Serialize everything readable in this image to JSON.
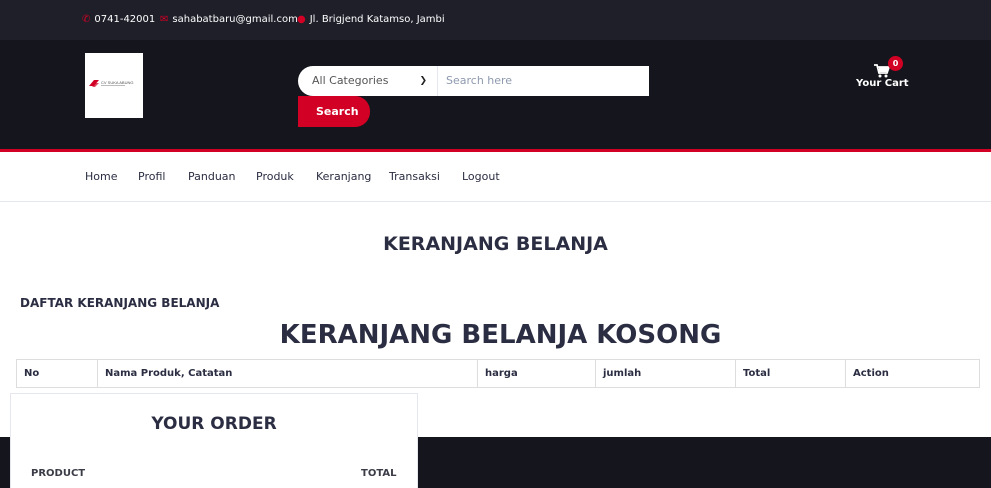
{
  "topbar": {
    "phone": "0741-42001",
    "email": "sahabatbaru@gmail.com",
    "address": "Jl. Brigjend Katamso, Jambi"
  },
  "brand": {
    "logo_text": "CV SUKA ABUNG",
    "colors": {
      "accent": "#d10024",
      "dark": "#15161d",
      "topbar": "#1e1f29"
    }
  },
  "search": {
    "category_selected": "All Categories",
    "placeholder": "Search here",
    "button_label": "Search"
  },
  "cart": {
    "qty": "0",
    "label": "Your Cart"
  },
  "nav": {
    "items": [
      "Home",
      "Profil",
      "Panduan",
      "Produk",
      "Keranjang",
      "Transaksi",
      "Logout"
    ]
  },
  "main": {
    "page_title": "KERANJANG BELANJA",
    "list_title": "DAFTAR KERANJANG BELANJA",
    "empty_message": "KERANJANG BELANJA KOSONG",
    "table_headers": [
      "No",
      "Nama Produk, Catatan",
      "harga",
      "jumlah",
      "Total",
      "Action"
    ]
  },
  "order": {
    "title": "YOUR ORDER",
    "col_product": "PRODUCT",
    "col_total": "TOTAL"
  },
  "icons": {
    "phone": "phone-icon",
    "email": "envelope-icon",
    "address": "map-marker-icon",
    "cart": "shopping-cart-icon",
    "select": "chevron-down-icon"
  }
}
